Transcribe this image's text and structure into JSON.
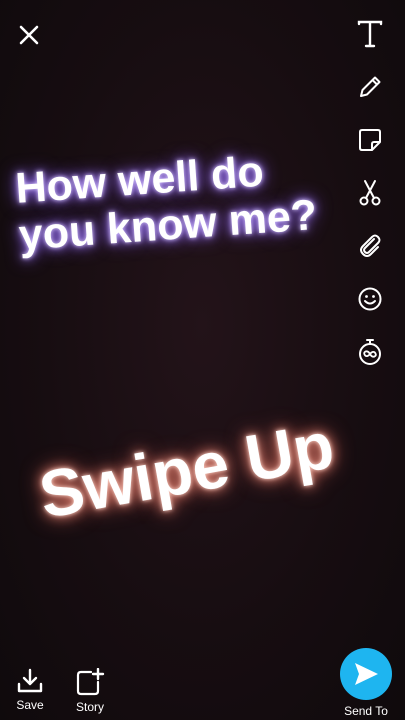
{
  "caption": {
    "line1": "How well do",
    "line2": "you know me?",
    "swipe": "Swipe Up"
  },
  "bottom": {
    "save_label": "Save",
    "story_label": "Story",
    "send_label": "Send To"
  },
  "colors": {
    "send_button": "#1eb5f0",
    "caption_glow": "#a27cff",
    "swipe_glow": "#e08070"
  },
  "icons": [
    "close-icon",
    "text-tool-icon",
    "pencil-icon",
    "sticker-icon",
    "scissors-icon",
    "paperclip-icon",
    "emoji-icon",
    "timer-icon",
    "download-icon",
    "add-story-icon",
    "send-arrow-icon"
  ]
}
